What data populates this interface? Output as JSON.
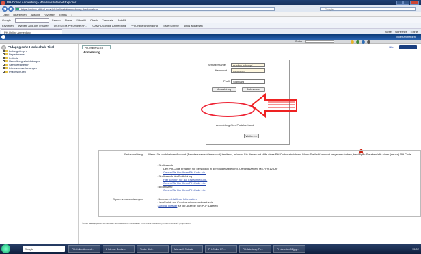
{
  "window": {
    "title": "PH-Online Anmeldung - Windows Internet Explorer"
  },
  "nav": {
    "url": "https://online.phtirol.ac.at/pls/online/wbanmeldung.durchfuehren",
    "search_placeholder": "Google",
    "back_icon": "back-arrow-icon",
    "forward_icon": "forward-arrow-icon"
  },
  "menu": [
    "Datei",
    "Bearbeiten",
    "Ansicht",
    "Favoriten",
    "Extras",
    "?"
  ],
  "toolbar": {
    "google_label": "Google",
    "items": [
      "Search",
      "Share",
      "Sidewiki",
      "Check",
      "Translate",
      "AutoFill"
    ]
  },
  "favorites": [
    "Favoriten",
    "Weitere Add-ons erhalten",
    "QSYSTEM-PH-Online-PH...",
    "CAMPUSonline Anmeldung",
    "PH-Online Anmeldung",
    "Erste Schritte",
    "Links anpassen"
  ],
  "tabs": [
    {
      "label": "PH-Online Anmeldung"
    }
  ],
  "commands": [
    "Seite",
    "Sicherheit",
    "Extras"
  ],
  "apphead": {
    "right": "Tiroler anmelden"
  },
  "apphead2": {
    "select_label": "Suche",
    "select_value": ""
  },
  "sidebar": {
    "title": "Pädagogische Hochschule Tirol",
    "items": [
      "Leitung der phf",
      "Departments",
      "Institute",
      "Verwaltungseinrichtungen",
      "Serviceeinheiten",
      "Interessenvertretungen",
      "Praxisschulen"
    ]
  },
  "content": {
    "tab": "PH-Online V2.93",
    "help": "Hilfe",
    "title": "Anmeldung",
    "login": {
      "user_label": "Benutzername",
      "user_value": "markus.schoepf",
      "pw_label": "Kennwort",
      "pw_value": "••••••••••••",
      "profile_label": "Profil",
      "profile_value": "Standard",
      "submit": "Anmeldung",
      "cancel": "Abbrechen",
      "portal_label": "Anmeldung über Portalverbund",
      "weiter": "Weiter >>"
    },
    "info": {
      "label1": "Erstanmeldung",
      "text1": "Wenn Sie noch keinen Account (Benutzername + Kennwort) besitzen, müssen Sie diesen mit Hilfe eines PH-Codes einrichten. Wenn Sie ihr Kennwort vergessen haben, benötigen Sie ebenfalls einen (neuen) PH-Code",
      "g1": "Studierende",
      "g1t": "Den PH-Code erhalten Sie persönlich in der Studienabteilung. Öffnungszeiten: Mo-Fr 9-12 Uhr",
      "g1l": "Geben Sie hier Ihren PH-Code ein.",
      "g2": "Studierende der Fortbildung",
      "g2l1": "Hier können Sie zur Erstanmeldung.",
      "g2l2": "Geben Sie hier Ihren PH-Code ein.",
      "g3": "Bedienstete",
      "g3l": "Geben Sie hier Ihren PH-Code ein.",
      "label2": "Systemvoraussetzungen",
      "s1": "Browser:",
      "s1l": "detaillierte Information",
      "s2": "JavaScript und Cookies müssen aktiviert sein",
      "s3l": "Acrobat Reader",
      "s3": "für die Anzeige von PDF-Dateien"
    },
    "copyright": "©2010 Pädagogische Hochschule Tirol. Alle Rechte vorbehalten | PH-Online powered by CAMPUSonline® | Impressum"
  },
  "taskbar": {
    "search": "Google",
    "tasks": [
      "PH-Online Anmeld...",
      "2 Internet Explorer",
      "Tiroler Bild...",
      "Microsoft Outlook",
      "PH-Online PR...",
      "PH-Anleitung (Pn...",
      "PH-Anleitun 02.jpg..."
    ],
    "clock": "15:02"
  }
}
